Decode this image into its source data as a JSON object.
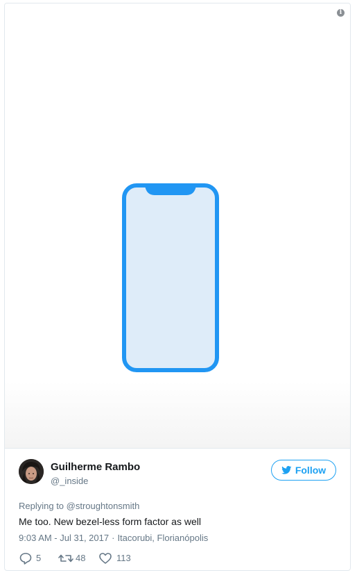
{
  "media": {
    "info_icon": "info-icon",
    "image_subject": "phone-outline-icon",
    "phone_colors": {
      "stroke": "#2196f3",
      "fill": "#deecf9"
    }
  },
  "author": {
    "name": "Guilherme Rambo",
    "handle": "@_inside",
    "avatar": "avatar-photo"
  },
  "follow_button": {
    "label": "Follow",
    "icon": "twitter-bird-icon",
    "color": "#1da1f2"
  },
  "tweet": {
    "reply_prefix": "Replying to",
    "reply_to": "@stroughtonsmith",
    "text": "Me too. New bezel-less form factor as well",
    "time": "9:03 AM - Jul 31, 2017",
    "separator": "·",
    "location": "Itacorubi, Florianópolis"
  },
  "actions": {
    "reply": {
      "icon": "reply-icon",
      "count": "5"
    },
    "retweet": {
      "icon": "retweet-icon",
      "count": "48"
    },
    "like": {
      "icon": "heart-icon",
      "count": "113"
    }
  }
}
